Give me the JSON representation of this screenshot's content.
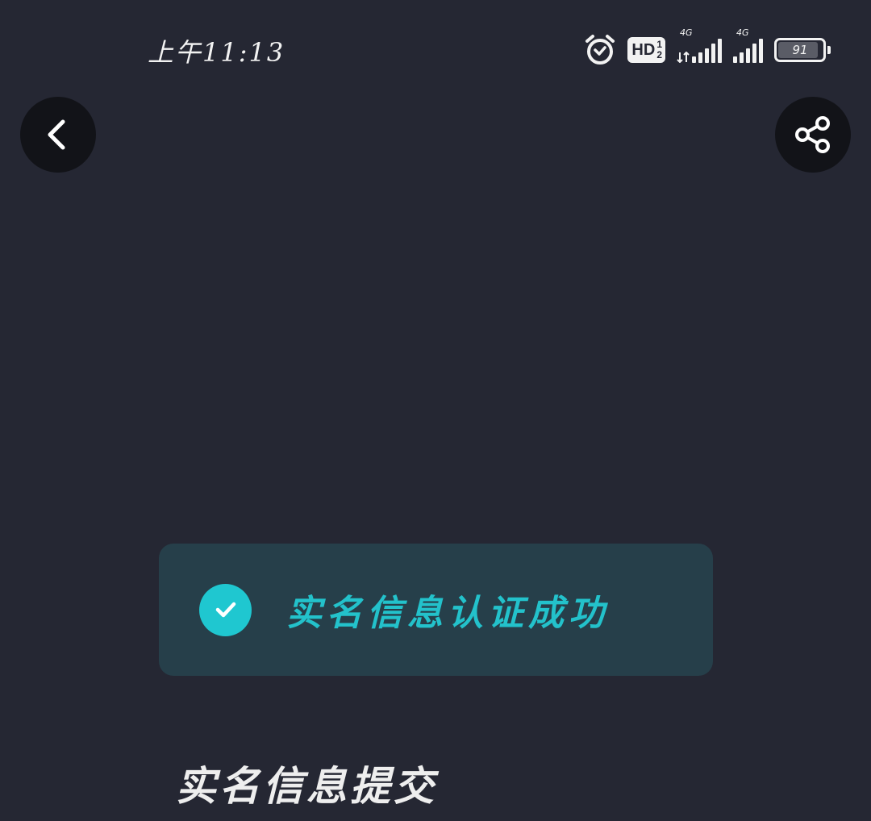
{
  "status_bar": {
    "time": "上午11:13",
    "alarm_icon": "alarm-clock-icon",
    "hd_label": "HD",
    "hd_sup": "1",
    "hd_sub": "2",
    "network_1": "4G",
    "network_2": "4G",
    "battery_level": "91"
  },
  "header": {
    "back_icon": "chevron-left-icon",
    "share_icon": "share-icon"
  },
  "toast": {
    "icon": "check-circle-icon",
    "message": "实名信息认证成功",
    "accent_color": "#1fc7d0"
  },
  "content": {
    "section_title": "实名信息提交"
  }
}
